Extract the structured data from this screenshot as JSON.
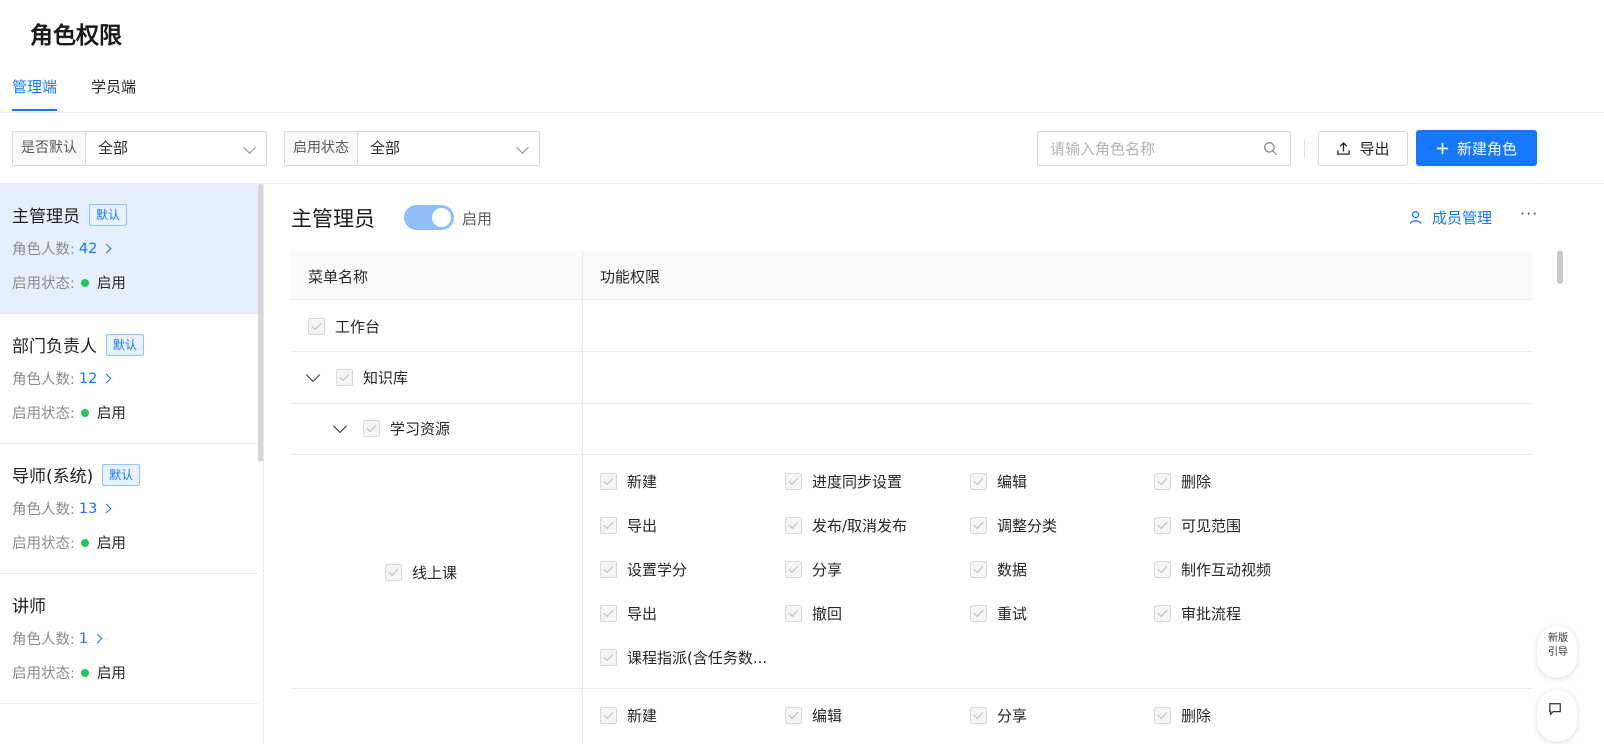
{
  "page": {
    "title": "角色权限"
  },
  "tabs": [
    {
      "label": "管理端",
      "active": true
    },
    {
      "label": "学员端",
      "active": false
    }
  ],
  "filters": [
    {
      "label": "是否默认",
      "value": "全部"
    },
    {
      "label": "启用状态",
      "value": "全部"
    }
  ],
  "search": {
    "placeholder": "请输入角色名称"
  },
  "actions": {
    "export_label": "导出",
    "new_label": "新建角色"
  },
  "roles": [
    {
      "name": "主管理员",
      "badge": "默认",
      "count_label": "角色人数:",
      "count": "42",
      "status_label": "启用状态:",
      "status": "启用",
      "active": true
    },
    {
      "name": "部门负责人",
      "badge": "默认",
      "count_label": "角色人数:",
      "count": "12",
      "status_label": "启用状态:",
      "status": "启用"
    },
    {
      "name": "导师(系统)",
      "badge": "默认",
      "count_label": "角色人数:",
      "count": "13",
      "status_label": "启用状态:",
      "status": "启用"
    },
    {
      "name": "讲师",
      "badge": "",
      "count_label": "角色人数:",
      "count": "1",
      "status_label": "启用状态:",
      "status": "启用"
    }
  ],
  "detail": {
    "title": "主管理员",
    "toggle_label": "启用",
    "toggle_on": true,
    "member_mgmt_label": "成员管理",
    "more_label": "···"
  },
  "table": {
    "headers": [
      "菜单名称",
      "功能权限"
    ],
    "menus": [
      {
        "label": "工作台",
        "level": 0,
        "expandable": false
      },
      {
        "label": "知识库",
        "level": 0,
        "expandable": true
      },
      {
        "label": "学习资源",
        "level": 1,
        "expandable": true
      },
      {
        "label": "线上课",
        "level": 2,
        "expandable": false
      }
    ],
    "online_course_perms": [
      [
        "新建",
        "进度同步设置",
        "编辑",
        "删除"
      ],
      [
        "导出",
        "发布/取消发布",
        "调整分类",
        "可见范围"
      ],
      [
        "设置学分",
        "分享",
        "数据",
        "制作互动视频"
      ],
      [
        "导出",
        "撤回",
        "重试",
        "审批流程"
      ],
      [
        "课程指派(含任务数..."
      ]
    ],
    "next_row_perms": [
      "新建",
      "编辑",
      "分享",
      "删除"
    ]
  },
  "float": {
    "btn1_line1": "新版",
    "btn1_line2": "引导",
    "btn2_icon": "chat-icon"
  },
  "colors": {
    "primary": "#1677ff",
    "active_bg": "#e6f0fd",
    "status_green": "#22c55e"
  }
}
